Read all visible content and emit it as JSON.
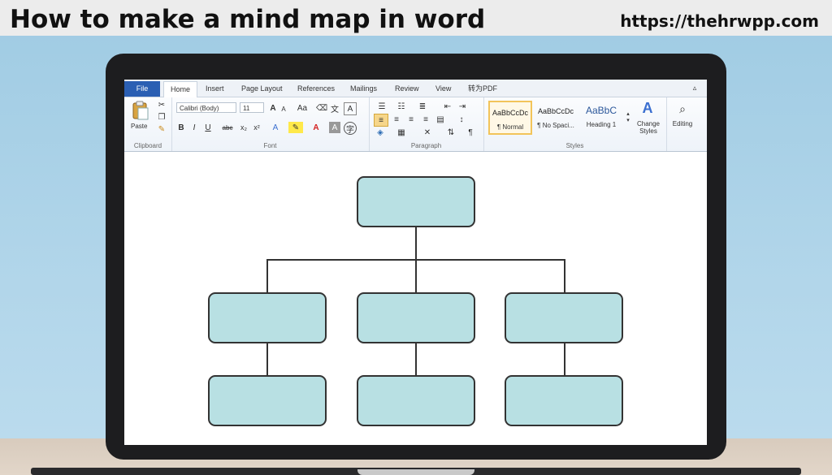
{
  "header": {
    "title": "How to make a mind map in word",
    "url": "https://thehrwpp.com"
  },
  "ribbon": {
    "tabs": [
      "File",
      "Home",
      "Insert",
      "Page Layout",
      "References",
      "Mailings",
      "Review",
      "View",
      "转为PDF"
    ],
    "clipboard": {
      "paste_label": "Paste",
      "group_label": "Clipboard"
    },
    "font": {
      "family": "Calibri (Body)",
      "size": "11",
      "group_label": "Font"
    },
    "paragraph": {
      "group_label": "Paragraph"
    },
    "styles": {
      "items": [
        {
          "sample": "AaBbCcDc",
          "name": "¶ Normal"
        },
        {
          "sample": "AaBbCcDc",
          "name": "¶ No Spaci..."
        },
        {
          "sample": "AaBbC",
          "name": "Heading 1"
        }
      ],
      "change_styles_label": "Change Styles",
      "group_label": "Styles"
    },
    "editing": {
      "label": "Editing"
    }
  },
  "colors": {
    "node_fill": "#b8e0e3",
    "file_tab": "#2b5fb3",
    "wall": "#a9d0e6"
  }
}
